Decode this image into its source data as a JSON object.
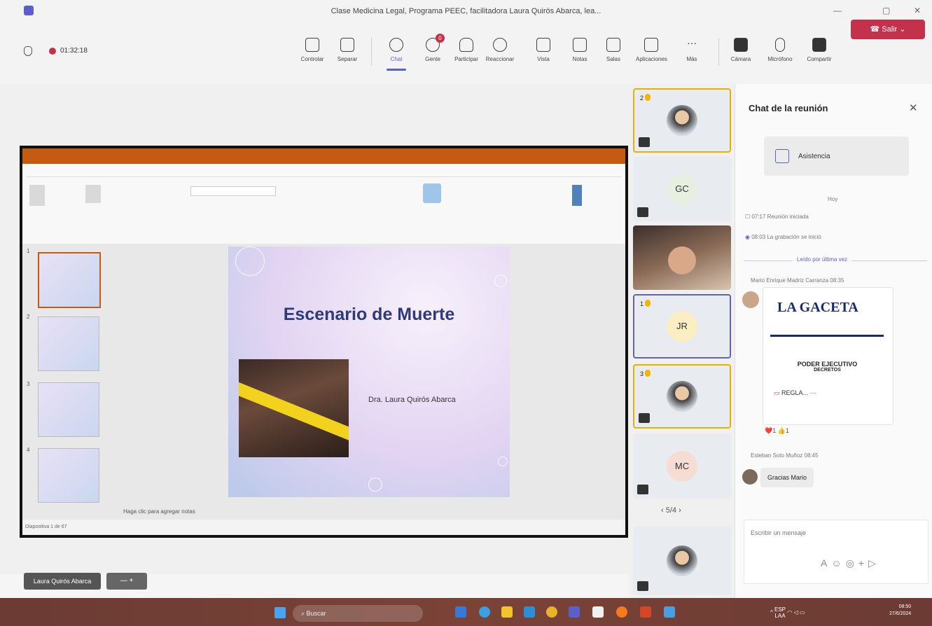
{
  "window": {
    "title": "Clase Medicina Legal, Programa PEEC, facilitadora Laura Quirós Abarca, lea..."
  },
  "meeting": {
    "timer": "01:32:18"
  },
  "toolbar": {
    "items": [
      {
        "label": "Controlar",
        "icon": "control-icon"
      },
      {
        "label": "Separar",
        "icon": "popout-icon"
      },
      {
        "label": "Chat",
        "icon": "chat-icon"
      },
      {
        "label": "Gente",
        "icon": "people-icon",
        "badge": "0"
      },
      {
        "label": "Participar",
        "icon": "raise-hand-icon"
      },
      {
        "label": "Reaccionar",
        "icon": "reaction-icon"
      },
      {
        "label": "Vista",
        "icon": "view-icon"
      },
      {
        "label": "Notas",
        "icon": "notes-icon"
      },
      {
        "label": "Salas",
        "icon": "rooms-icon"
      },
      {
        "label": "Aplicaciones",
        "icon": "apps-icon"
      },
      {
        "label": "Más",
        "icon": "more-icon"
      }
    ],
    "devices": [
      {
        "label": "Cámara",
        "icon": "camera-off-icon"
      },
      {
        "label": "Micrófono",
        "icon": "mic-off-icon"
      },
      {
        "label": "Compartir",
        "icon": "share-icon"
      }
    ],
    "leave": "Salir"
  },
  "slide": {
    "title": "Escenario de Muerte",
    "author": "Dra. Laura Quirós Abarca",
    "notes_placeholder": "Haga clic para agregar notas",
    "slide_counter": "Diapositiva 1 de 67"
  },
  "presenter": {
    "name": "Laura Quirós Abarca"
  },
  "participants": {
    "tiles": [
      {
        "initials": "",
        "raise": "2"
      },
      {
        "initials": "GC",
        "raise": ""
      },
      {
        "initials": "",
        "raise": ""
      },
      {
        "initials": "JR",
        "raise": "1"
      },
      {
        "initials": "",
        "raise": "3"
      },
      {
        "initials": "MC",
        "raise": ""
      },
      {
        "initials": "",
        "raise": ""
      }
    ],
    "pager": "5/4"
  },
  "chat": {
    "title": "Chat de la reunión",
    "asistencia": "Asistencia",
    "day": "Hoy",
    "events": [
      {
        "time": "07:17",
        "text": "Reunión iniciada"
      },
      {
        "time": "08:03",
        "text": "La grabación se inició"
      }
    ],
    "read_marker": "Leído por última vez",
    "sender1": "Mario Enrique Madriz Carranza 08:35",
    "gaceta": "LA GACETA",
    "poder": "PODER EJECUTIVO",
    "decretos": "DECRETOS",
    "file_name": "REGLA...",
    "reactions": "❤️1  👍1",
    "sender2": "Esteban Soto Muñoz 08:45",
    "msg2": "Gracias Mario",
    "compose_placeholder": "Escribir un mensaje"
  },
  "taskbar": {
    "search": "Buscar",
    "lang": "ESP",
    "lang2": "LAA",
    "time": "08:50",
    "date": "27/6/2024"
  }
}
